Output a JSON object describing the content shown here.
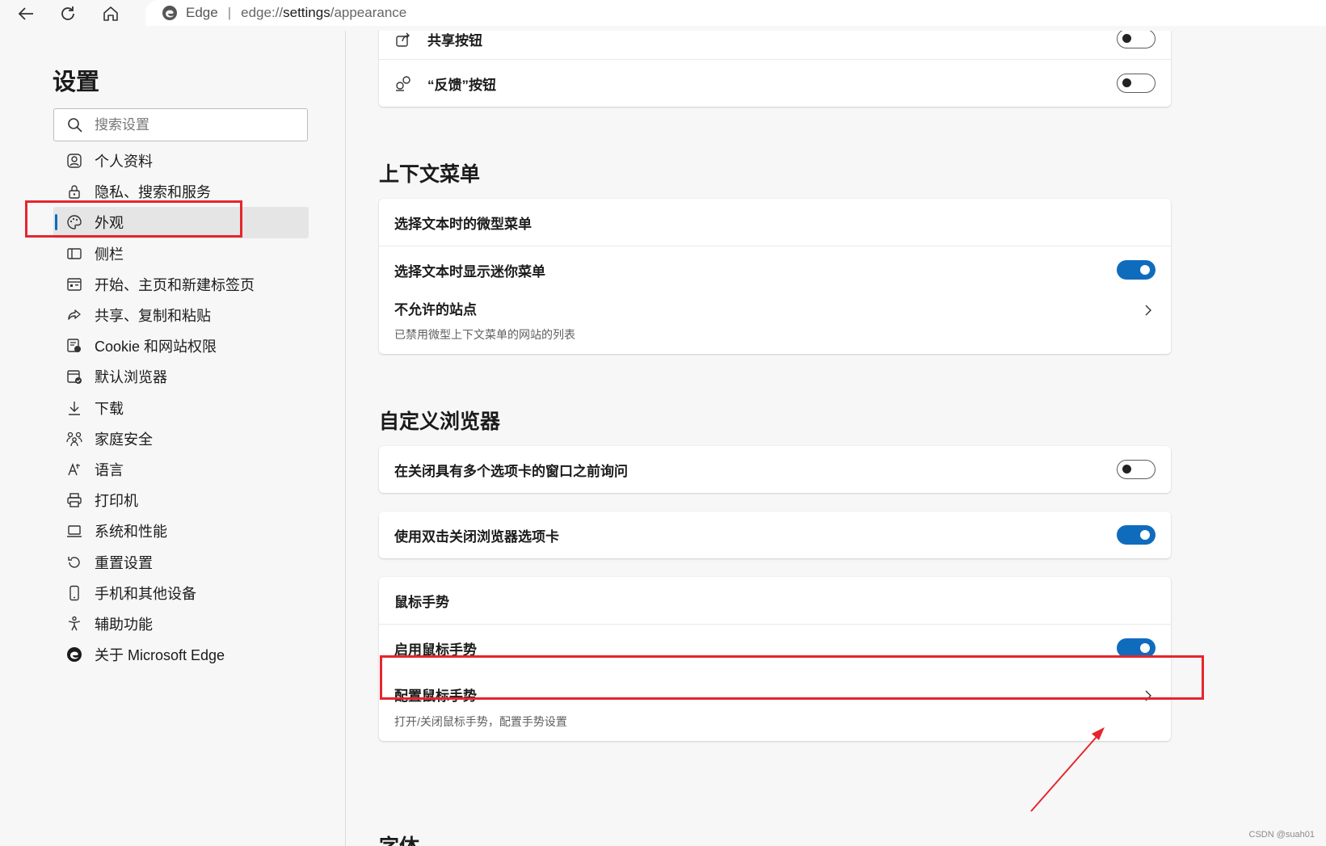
{
  "browser": {
    "brand": "Edge",
    "url_prefix": "edge://",
    "url_host": "settings",
    "url_path": "/appearance"
  },
  "sidebar": {
    "title": "设置",
    "search_placeholder": "搜索设置",
    "items": [
      {
        "label": "个人资料",
        "icon": "profile-icon"
      },
      {
        "label": "隐私、搜索和服务",
        "icon": "lock-icon"
      },
      {
        "label": "外观",
        "icon": "palette-icon",
        "active": true
      },
      {
        "label": "侧栏",
        "icon": "sidebar-icon"
      },
      {
        "label": "开始、主页和新建标签页",
        "icon": "home-tab-icon"
      },
      {
        "label": "共享、复制和粘贴",
        "icon": "share-icon"
      },
      {
        "label": "Cookie 和网站权限",
        "icon": "cookie-icon"
      },
      {
        "label": "默认浏览器",
        "icon": "browser-icon"
      },
      {
        "label": "下载",
        "icon": "download-icon"
      },
      {
        "label": "家庭安全",
        "icon": "family-icon"
      },
      {
        "label": "语言",
        "icon": "language-icon"
      },
      {
        "label": "打印机",
        "icon": "printer-icon"
      },
      {
        "label": "系统和性能",
        "icon": "laptop-icon"
      },
      {
        "label": "重置设置",
        "icon": "reset-icon"
      },
      {
        "label": "手机和其他设备",
        "icon": "phone-icon"
      },
      {
        "label": "辅助功能",
        "icon": "accessibility-icon"
      },
      {
        "label": "关于 Microsoft Edge",
        "icon": "edge-icon"
      }
    ]
  },
  "main": {
    "top_card": {
      "share_button": {
        "label": "共享按钮",
        "enabled": false
      },
      "feedback_button": {
        "label": "“反馈”按钮",
        "enabled": false
      }
    },
    "context_menu": {
      "title": "上下文菜单",
      "header": "选择文本时的微型菜单",
      "show_mini_menu": {
        "label": "选择文本时显示迷你菜单",
        "enabled": true
      },
      "disallowed_sites": {
        "label": "不允许的站点",
        "description": "已禁用微型上下文菜单的网站的列表"
      }
    },
    "customize": {
      "title": "自定义浏览器",
      "ask_before_close": {
        "label": "在关闭具有多个选项卡的窗口之前询问",
        "enabled": false
      },
      "double_click_close": {
        "label": "使用双击关闭浏览器选项卡",
        "enabled": true
      },
      "mouse_gesture_header": "鼠标手势",
      "enable_mouse_gesture": {
        "label": "启用鼠标手势",
        "enabled": true
      },
      "config_mouse_gesture": {
        "label": "配置鼠标手势",
        "description": "打开/关闭鼠标手势，配置手势设置"
      }
    },
    "fonts_title": "字体"
  },
  "annotation": {
    "color": "#e5262e"
  },
  "watermark": "CSDN @suah01",
  "colors": {
    "accent": "#0f6cbd",
    "background": "#f7f7f7"
  }
}
